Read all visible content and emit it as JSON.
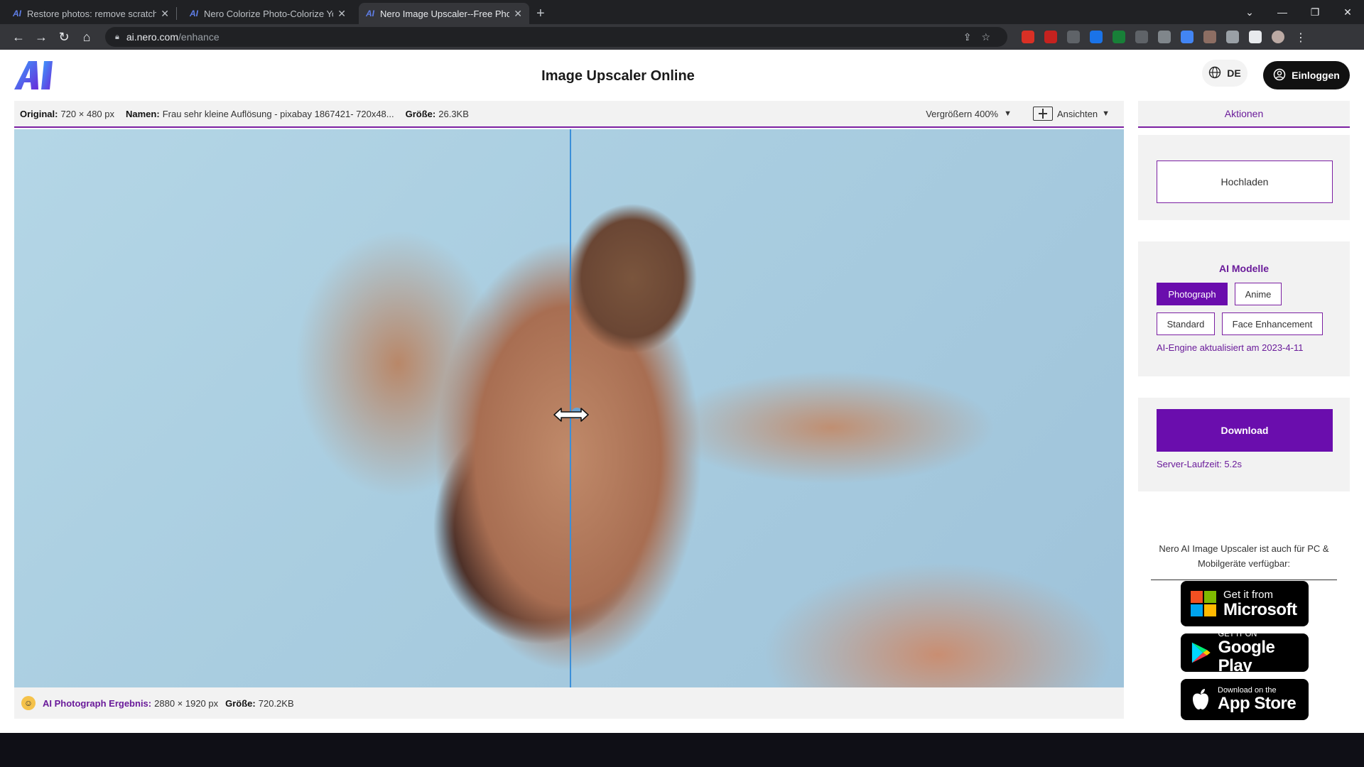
{
  "browser": {
    "tabs": [
      {
        "favicon": "AI",
        "title": "Restore photos: remove scratches"
      },
      {
        "favicon": "AI",
        "title": "Nero Colorize Photo-Colorize Your"
      },
      {
        "favicon": "AI",
        "title": "Nero Image Upscaler--Free Photo"
      }
    ],
    "url_host": "ai.nero.com",
    "url_path": "/enhance"
  },
  "header": {
    "title": "Image Upscaler Online",
    "language": "DE",
    "login_label": "Einloggen"
  },
  "infobar": {
    "original_label": "Original:",
    "original_value": "720 × 480 px",
    "name_label": "Namen:",
    "name_value": "Frau sehr kleine Auflösung - pixabay 1867421- 720x48...",
    "size_label": "Größe:",
    "size_value": "26.3KB",
    "zoom_label": "Vergrößern 400%",
    "views_label": "Ansichten"
  },
  "result": {
    "label": "AI Photograph Ergebnis:",
    "dimensions": "2880 × 1920 px",
    "size_label": "Größe:",
    "size_value": "720.2KB"
  },
  "panel": {
    "actions_tab": "Aktionen",
    "upload_label": "Hochladen",
    "models_title": "AI Modelle",
    "models": [
      "Photograph",
      "Anime",
      "Standard",
      "Face Enhancement"
    ],
    "selected_model": "Photograph",
    "engine_note": "AI-Engine aktualisiert am 2023-4-11",
    "download_label": "Download",
    "server_time": "Server-Laufzeit: 5.2s",
    "availability_text": "Nero AI Image Upscaler ist auch für PC & Mobilgeräte verfügbar:",
    "stores": [
      {
        "small": "Get it from",
        "big": "Microsoft"
      },
      {
        "small": "GET IT ON",
        "big": "Google Play"
      },
      {
        "small": "Download on the",
        "big": "App Store"
      }
    ]
  },
  "colors": {
    "accent": "#6a0dad",
    "accent_line": "#7b1fa2",
    "divider": "#3b8fd9"
  }
}
